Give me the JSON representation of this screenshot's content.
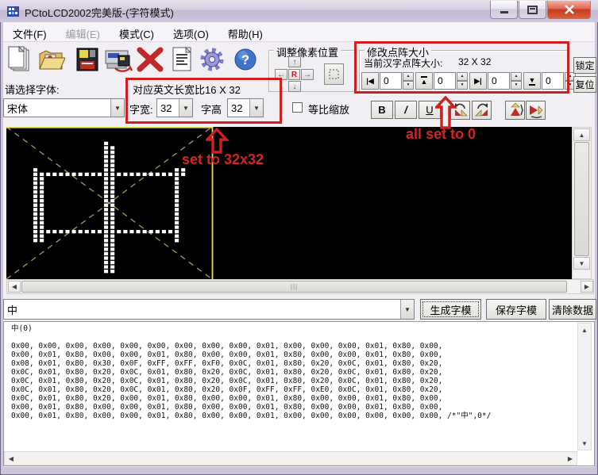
{
  "window": {
    "title": "PCtoLCD2002完美版-(字符模式)"
  },
  "menu": [
    {
      "label": "文件(F)",
      "enabled": true
    },
    {
      "label": "编辑(E)",
      "enabled": false
    },
    {
      "label": "模式(C)",
      "enabled": true
    },
    {
      "label": "选项(O)",
      "enabled": true
    },
    {
      "label": "帮助(H)",
      "enabled": true
    }
  ],
  "toolbar_icons": [
    "new-document",
    "open-file",
    "save",
    "save-as",
    "delete",
    "char-code",
    "settings",
    "help"
  ],
  "font_section": {
    "select_label": "请选择字体:",
    "font_name": "宋体",
    "ratio_text": "对应英文长宽比16 X 32",
    "width_label": "字宽:",
    "width_value": "32",
    "height_label": "字高",
    "height_value": "32",
    "scale_label": "等比缩放",
    "bold": "B",
    "italic": "/",
    "underline": "U"
  },
  "pixel_position": {
    "title": "调整像素位置",
    "r_label": "R"
  },
  "matrix_size": {
    "title": "修改点阵大小",
    "current_label": "当前汉字点阵大小:",
    "current_value": "32 X 32",
    "spinners": [
      {
        "icon": "left-edge-icon",
        "value": "0"
      },
      {
        "icon": "top-edge-icon",
        "value": "0"
      },
      {
        "icon": "right-edge-icon",
        "value": "0"
      },
      {
        "icon": "bottom-edge-icon",
        "value": "0"
      }
    ],
    "lock_label": "锁定",
    "reset_label": "复位"
  },
  "annotations": {
    "size_note": "set to 32x32",
    "zero_note": "all set to 0",
    "red": "#cf2020"
  },
  "charbar": {
    "current_char": "中",
    "generate_label": "生成字模",
    "save_label": "保存字模",
    "clear_label": "清除数据"
  },
  "lcd": {
    "columns": 32,
    "rows": 32,
    "pixel_color": "#ffffff",
    "guide_color": "#a29b5e",
    "cell_border_color": "#e3da55"
  },
  "output": {
    "header": "中(0)",
    "hex_lines": [
      "0x00, 0x00, 0x00, 0x00, 0x00, 0x00, 0x00, 0x00, 0x00, 0x01, 0x00, 0x00, 0x00, 0x01, 0x80, 0x00,",
      "0x00, 0x01, 0x80, 0x00, 0x00, 0x01, 0x80, 0x00, 0x00, 0x01, 0x80, 0x00, 0x00, 0x01, 0x80, 0x00,",
      "0x08, 0x01, 0x80, 0x30, 0x0F, 0xFF, 0xFF, 0xF0, 0x0C, 0x01, 0x80, 0x20, 0x0C, 0x01, 0x80, 0x20,",
      "0x0C, 0x01, 0x80, 0x20, 0x0C, 0x01, 0x80, 0x20, 0x0C, 0x01, 0x80, 0x20, 0x0C, 0x01, 0x80, 0x20,",
      "0x0C, 0x01, 0x80, 0x20, 0x0C, 0x01, 0x80, 0x20, 0x0C, 0x01, 0x80, 0x20, 0x0C, 0x01, 0x80, 0x20,",
      "0x0C, 0x01, 0x80, 0x20, 0x0C, 0x01, 0x80, 0x20, 0x0F, 0xFF, 0xFF, 0xE0, 0x0C, 0x01, 0x80, 0x20,",
      "0x0C, 0x01, 0x80, 0x20, 0x00, 0x01, 0x80, 0x00, 0x00, 0x01, 0x80, 0x00, 0x00, 0x01, 0x80, 0x00,",
      "0x00, 0x01, 0x80, 0x00, 0x00, 0x01, 0x80, 0x00, 0x00, 0x01, 0x80, 0x00, 0x00, 0x01, 0x80, 0x00,",
      "0x00, 0x01, 0x80, 0x00, 0x00, 0x01, 0x80, 0x00, 0x00, 0x01, 0x00, 0x00, 0x00, 0x00, 0x00, 0x00, /*\"中\",0*/"
    ]
  }
}
